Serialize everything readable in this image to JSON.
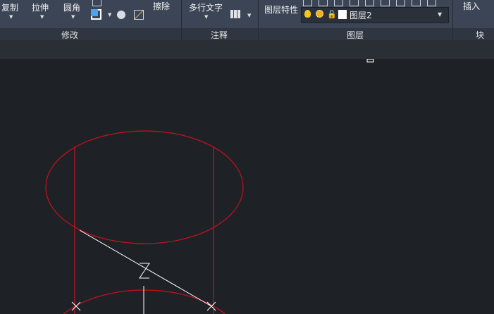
{
  "ribbon": {
    "modify": {
      "copy": "复制",
      "stretch": "拉伸",
      "fillet": "圆角",
      "erase": "擦除",
      "panel": "修改"
    },
    "annotation": {
      "mtext": "多行文字",
      "panel": "注释"
    },
    "layers": {
      "properties": "图层特性",
      "current_layer": "图层2",
      "panel": "图层"
    },
    "block": {
      "insert": "插入",
      "panel": "块"
    }
  },
  "canvas": {
    "ucs_label": "Z",
    "line_color": "#c8101c"
  }
}
